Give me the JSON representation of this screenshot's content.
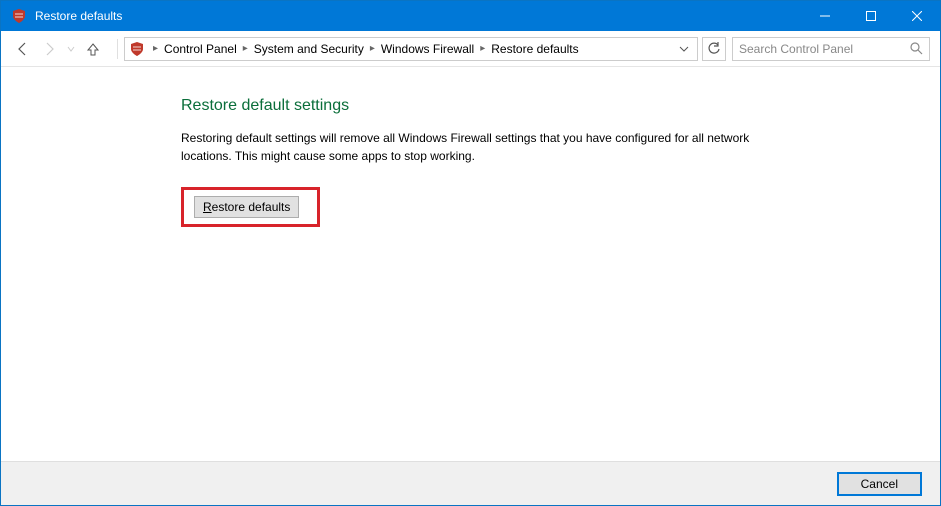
{
  "titlebar": {
    "title": "Restore defaults"
  },
  "breadcrumb": {
    "items": [
      "Control Panel",
      "System and Security",
      "Windows Firewall",
      "Restore defaults"
    ]
  },
  "search": {
    "placeholder": "Search Control Panel"
  },
  "content": {
    "heading": "Restore default settings",
    "body": "Restoring default settings will remove all Windows Firewall settings that you have configured for all network locations. This might cause some apps to stop working.",
    "button_mnemonic": "R",
    "button_rest": "estore defaults"
  },
  "footer": {
    "cancel": "Cancel"
  }
}
